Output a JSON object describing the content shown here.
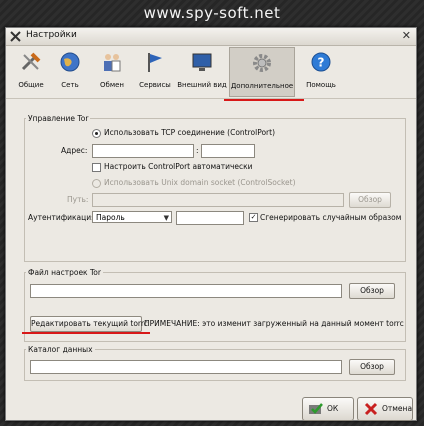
{
  "watermark": "www.spy-soft.net",
  "window": {
    "title": "Настройки"
  },
  "toolbar": {
    "items": [
      {
        "label": "Общие",
        "icon": "wrench-hammer-icon"
      },
      {
        "label": "Сеть",
        "icon": "globe-icon"
      },
      {
        "label": "Обмен",
        "icon": "people-icon"
      },
      {
        "label": "Сервисы",
        "icon": "flag-icon"
      },
      {
        "label": "Внешний вид",
        "icon": "monitor-icon"
      },
      {
        "label": "Дополнительное",
        "icon": "gear-icon",
        "active": true
      },
      {
        "label": "Помощь",
        "icon": "help-icon"
      }
    ]
  },
  "tor_control": {
    "group_label": "Управление Tor",
    "use_tcp": "Использовать TCP соединение (ControlPort)",
    "address_label": "Адрес:",
    "address_value": "",
    "port_separator": ":",
    "port_value": "",
    "auto_config": "Настроить ControlPort автоматически",
    "auto_config_checked": false,
    "use_unix": "Использовать Unix domain socket (ControlSocket)",
    "path_label": "Путь:",
    "path_value": "",
    "browse": "Обзор",
    "auth_label": "Аутентификация:",
    "auth_selected": "Пароль",
    "password_value": "",
    "generate_random": "Сгенерировать случайным образом",
    "generate_random_checked": true
  },
  "torrc": {
    "group_label": "Файл настроек Tor",
    "path_value": "",
    "browse": "Обзор",
    "edit_button": "Редактировать текущий torrc",
    "note": "ПРИМЕЧАНИЕ: это изменит загруженный на данный момент torrc"
  },
  "data_dir": {
    "group_label": "Каталог данных",
    "path_value": "",
    "browse": "Обзор"
  },
  "buttons": {
    "ok": "ОК",
    "cancel": "Отмена"
  },
  "colors": {
    "highlight": "#d81818",
    "window_bg": "#ece9e3"
  }
}
